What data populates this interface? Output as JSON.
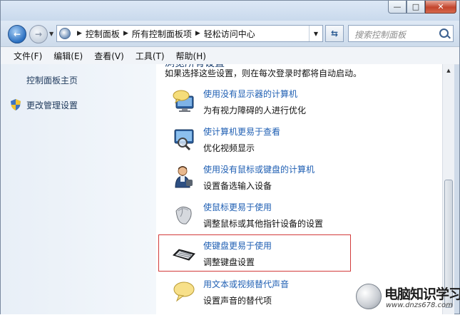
{
  "address": {
    "breadcrumbs": [
      "控制面板",
      "所有控制面板项",
      "轻松访问中心"
    ],
    "search_placeholder": "搜索控制面板"
  },
  "window_buttons": {
    "minimize": "—",
    "maximize": "□",
    "close": "✕"
  },
  "menu": [
    "文件(F)",
    "编辑(E)",
    "查看(V)",
    "工具(T)",
    "帮助(H)"
  ],
  "sidebar": {
    "links": [
      "控制面板主页",
      "更改管理设置"
    ]
  },
  "content": {
    "clipped_heading": "浏览所有设置",
    "intro": "如果选择这些设置，则在每次登录时都将自动启动。",
    "items": [
      {
        "link": "使用没有显示器的计算机",
        "desc": "为有视力障碍的人进行优化",
        "icon": "speech-monitor-icon"
      },
      {
        "link": "使计算机更易于查看",
        "desc": "优化视频显示",
        "icon": "magnifier-monitor-icon"
      },
      {
        "link": "使用没有鼠标或键盘的计算机",
        "desc": "设置备选输入设备",
        "icon": "person-icon"
      },
      {
        "link": "使鼠标更易于使用",
        "desc": "调整鼠标或其他指针设备的设置",
        "icon": "mouse-icon"
      },
      {
        "link": "使键盘更易于使用",
        "desc": "调整键盘设置",
        "icon": "keyboard-icon"
      },
      {
        "link": "用文本或视频替代声音",
        "desc": "设置声音的替代项",
        "icon": "speech-bubble-icon"
      }
    ],
    "highlight_color": "#d23b3b"
  },
  "watermark": {
    "title": "电脑知识学习网",
    "url": "www.dnzs678.com"
  }
}
